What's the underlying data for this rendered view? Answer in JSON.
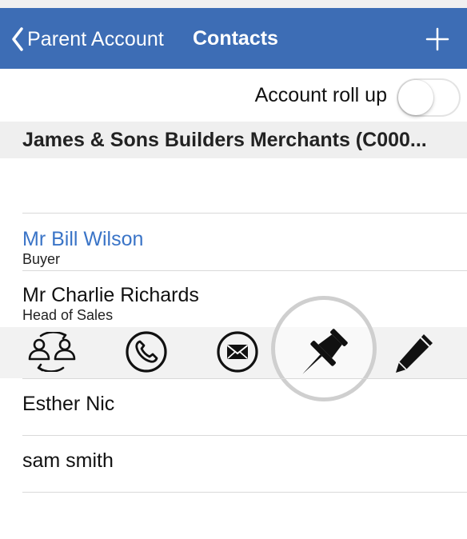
{
  "colors": {
    "navbar": "#3d6db5",
    "link": "#3a74c7",
    "section_bg": "#efefef",
    "action_bar_bg": "#f2f2f2"
  },
  "navbar": {
    "back_label": "Parent Account",
    "title": "Contacts",
    "back_icon": "chevron-left-icon",
    "add_icon": "plus-icon"
  },
  "rollup": {
    "label": "Account roll up",
    "enabled": false
  },
  "account": {
    "name": "James & Sons Builders Merchants (C000..."
  },
  "contacts": [
    {
      "name": "Mr Bill Wilson",
      "role": "Buyer"
    },
    {
      "name": "Mr Charlie Richards",
      "role": "Head of Sales"
    },
    {
      "name": "Esther Nic",
      "role": ""
    },
    {
      "name": "sam smith",
      "role": ""
    }
  ],
  "actions": [
    {
      "icon": "switch-contact-icon"
    },
    {
      "icon": "phone-icon"
    },
    {
      "icon": "email-icon"
    },
    {
      "icon": "pin-icon"
    },
    {
      "icon": "edit-icon"
    }
  ]
}
